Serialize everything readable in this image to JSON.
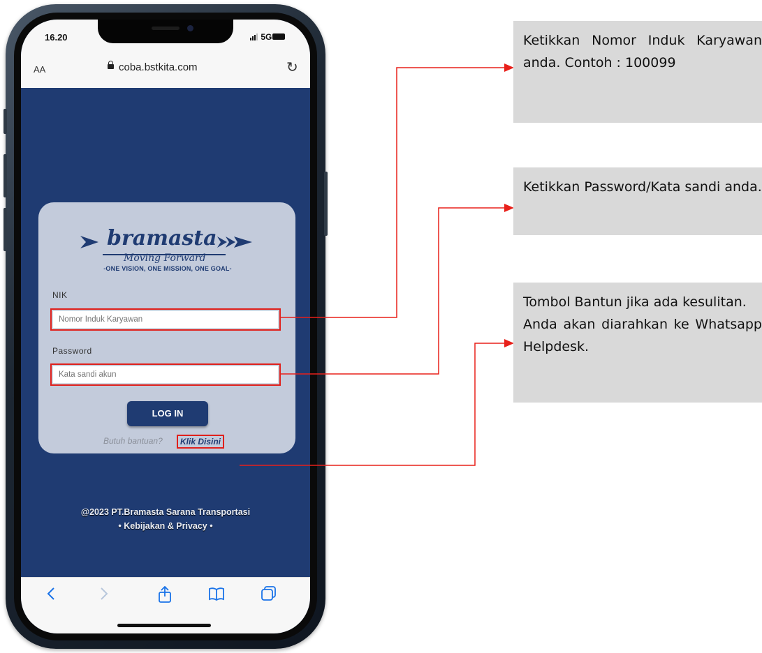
{
  "status_bar": {
    "time": "16.20",
    "signal": "5G"
  },
  "browser": {
    "text_size_button": "AA",
    "url": "coba.bstkita.com"
  },
  "logo": {
    "name": "bramasta",
    "tagline": "Moving Forward",
    "motto": "-ONE VISION, ONE MISSION, ONE GOAL-"
  },
  "form": {
    "nik_label": "NIK",
    "nik_placeholder": "Nomor Induk Karyawan",
    "password_label": "Password",
    "password_placeholder": "Kata sandi akun",
    "login_button": "LOG IN",
    "help_question": "Butuh bantuan?",
    "help_link": "Klik Disini"
  },
  "footer": {
    "copyright": "@2023 PT.Bramasta Sarana Transportasi",
    "policy": "• Kebijakan & Privacy •"
  },
  "annotations": {
    "nik_note": "Ketikkan Nomor Induk Karyawan anda. Contoh : 100099",
    "password_note": "Ketikkan Password/Kata sandi anda.",
    "help_note_1": "Tombol Bantun jika ada kesulitan.",
    "help_note_2": "Anda akan diarahkan ke Whatsapp Helpdesk."
  },
  "colors": {
    "brand_blue": "#1f3b72",
    "highlight_red": "#e0201b",
    "note_bg": "#d9d9d9"
  }
}
